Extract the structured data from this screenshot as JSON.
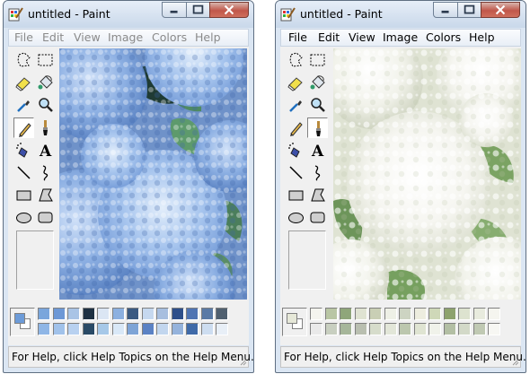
{
  "windows": [
    {
      "title": "untitled - Paint",
      "active": false,
      "menu": [
        "File",
        "Edit",
        "View",
        "Image",
        "Colors",
        "Help"
      ],
      "status": "For Help, click Help Topics on the Help Menu.",
      "image": "blue-hydrangea-photo",
      "foreground_color": "#6c9bd8",
      "background_color": "#ffffff",
      "palette": [
        [
          "#7aa6dc",
          "#6d98d6",
          "#a9c4e6",
          "#1e3042",
          "#dbe6f4",
          "#8cb0e0",
          "#3b5a82",
          "#c6d8ef",
          "#a7bedf",
          "#2e4f8a",
          "#4f74b3",
          "#5a7aa6",
          "#506070"
        ],
        [
          "#8fb6e6",
          "#a1c2ea",
          "#b8d1f0",
          "#2a4a66",
          "#a6c8e8",
          "#d9e8f7",
          "#7ea4d6",
          "#5b82c4",
          "#c2d6ee",
          "#95b3dc",
          "#3f6aa8",
          "#cdddf0",
          "#e8eff7"
        ]
      ]
    },
    {
      "title": "untitled - Paint",
      "active": true,
      "menu": [
        "File",
        "Edit",
        "View",
        "Image",
        "Colors",
        "Help"
      ],
      "status": "For Help, click Help Topics on the Help Menu.",
      "image": "white-hydrangea-photo",
      "foreground_color": "#e6e8d8",
      "background_color": "#ffffff",
      "palette": [
        [
          "#f4f4ee",
          "#b9c6a4",
          "#8fa67a",
          "#dfe3d2",
          "#c9cfb5",
          "#eef0e6",
          "#cdd4c2",
          "#ededdf",
          "#cfd8b8",
          "#8ea36e",
          "#dde3cf",
          "#e8ebde",
          "#f5f5ef"
        ],
        [
          "#e9e9e9",
          "#c8cfc0",
          "#a6b69a",
          "#b9bfb0",
          "#d6dccb",
          "#e2e6d8",
          "#bcc7ae",
          "#dfe4d2",
          "#f0f2ea",
          "#b3bfa4",
          "#d3d9c8",
          "#c0c9b3",
          "#f7f7f3"
        ]
      ]
    }
  ]
}
